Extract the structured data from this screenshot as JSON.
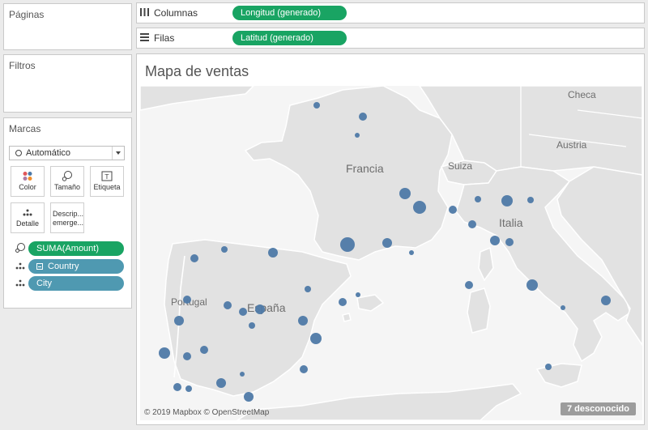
{
  "pages_card": {
    "title": "Páginas"
  },
  "filters_card": {
    "title": "Filtros"
  },
  "marks_card": {
    "title": "Marcas",
    "mark_type": "Automático",
    "buttons": [
      "Color",
      "Tamaño",
      "Etiqueta",
      "Detalle",
      "Descrip... emerge..."
    ],
    "fields": [
      {
        "label": "SUMA(Amount)",
        "role": "size",
        "color": "#19a463"
      },
      {
        "label": "Country",
        "role": "detail",
        "color": "#4f99b1"
      },
      {
        "label": "City",
        "role": "detail",
        "color": "#4f99b1"
      }
    ]
  },
  "shelves": {
    "columns_label": "Columnas",
    "columns_pill": "Longitud (generado)",
    "rows_label": "Filas",
    "rows_pill": "Latitud (generado)"
  },
  "view": {
    "title": "Mapa de ventas",
    "attribution": "© 2019 Mapbox © OpenStreetMap",
    "unknown_badge": "7 desconocido",
    "map_labels": [
      "Checa",
      "Austria",
      "Francia",
      "Suiza",
      "Italia",
      "Portugal",
      "España"
    ],
    "mark_color": "#4e79a7"
  }
}
